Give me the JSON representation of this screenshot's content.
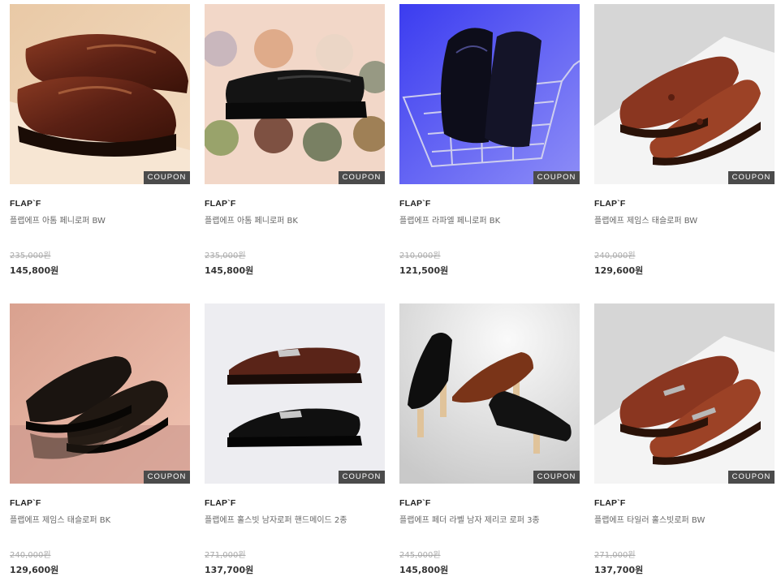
{
  "coupon_label": "COUPON",
  "products": [
    {
      "brand": "FLAP`F",
      "name": "플랩에프 아톰 페니로퍼 BW",
      "original_price": "235,000원",
      "sale_price": "145,800원",
      "image": "brown-penny-loafers-on-box"
    },
    {
      "brand": "FLAP`F",
      "name": "플랩에프 아톰 페니로퍼 BK",
      "original_price": "235,000원",
      "sale_price": "145,800원",
      "image": "black-penny-loafer-with-glasses"
    },
    {
      "brand": "FLAP`F",
      "name": "플랩에프 라파엘 페니로퍼 BK",
      "original_price": "210,000원",
      "sale_price": "121,500원",
      "image": "black-loafers-in-shopping-cart"
    },
    {
      "brand": "FLAP`F",
      "name": "플랩에프 제임스 태슬로퍼 BW",
      "original_price": "240,000원",
      "sale_price": "129,600원",
      "image": "brown-tassel-loafers"
    },
    {
      "brand": "FLAP`F",
      "name": "플랩에프 제임스 태슬로퍼 BK",
      "original_price": "240,000원",
      "sale_price": "129,600원",
      "image": "black-tassel-loafers-on-mirror"
    },
    {
      "brand": "FLAP`F",
      "name": "플랩에프 홀스빗 남자로퍼 핸드메이드 2종",
      "original_price": "271,000원",
      "sale_price": "137,700원",
      "image": "horsebit-loafers-brown-and-black"
    },
    {
      "brand": "FLAP`F",
      "name": "플랩에프 페더 라벨 남자 제리코 로퍼 3종",
      "original_price": "245,000원",
      "sale_price": "145,800원",
      "image": "three-loafers-on-wood-stands"
    },
    {
      "brand": "FLAP`F",
      "name": "플랩에프 타일러 홀스빗로퍼 BW",
      "original_price": "271,000원",
      "sale_price": "137,700원",
      "image": "brown-horsebit-loafers"
    }
  ]
}
